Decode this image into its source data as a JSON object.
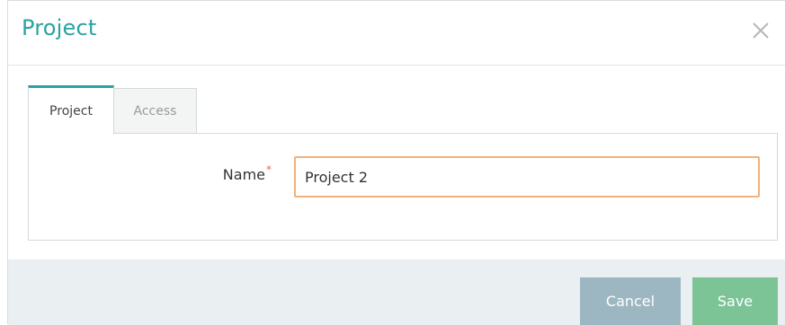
{
  "dialog": {
    "title": "Project",
    "close_icon": "close-icon"
  },
  "tabs": [
    {
      "label": "Project",
      "active": true
    },
    {
      "label": "Access",
      "active": false
    }
  ],
  "form": {
    "name_label": "Name",
    "required_marker": "*",
    "name_value": "Project 2"
  },
  "footer": {
    "cancel_label": "Cancel",
    "save_label": "Save"
  },
  "colors": {
    "accent": "#2aa3a1",
    "input_focus_border": "#f0b27a",
    "cancel_bg": "#9cb7c1",
    "save_bg": "#7cc396",
    "footer_bg": "#eaf0f2",
    "required": "#e06a5e"
  }
}
